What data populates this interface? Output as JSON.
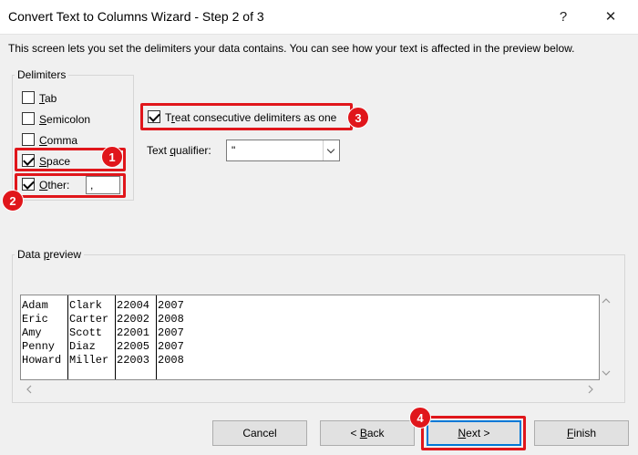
{
  "window": {
    "title": "Convert Text to Columns Wizard - Step 2 of 3",
    "help_glyph": "?",
    "close_glyph": "✕"
  },
  "instructions": "This screen lets you set the delimiters your data contains.  You can see how your text is affected in the preview below.",
  "delimiters": {
    "label": "Delimiters",
    "tab": {
      "pre": "",
      "key": "T",
      "post": "ab",
      "checked": false
    },
    "semicolon": {
      "pre": "",
      "key": "S",
      "post": "emicolon",
      "checked": false
    },
    "comma": {
      "pre": "",
      "key": "C",
      "post": "omma",
      "checked": false
    },
    "space": {
      "pre": "",
      "key": "S",
      "post": "pace",
      "checked": true
    },
    "other": {
      "pre": "",
      "key": "O",
      "post": "ther:",
      "checked": true,
      "value": ","
    }
  },
  "consecutive": {
    "pre": "T",
    "key": "r",
    "post": "eat consecutive delimiters as one",
    "checked": true
  },
  "qualifier": {
    "pre": "Text ",
    "key": "q",
    "post": "ualifier:",
    "value": "\""
  },
  "preview": {
    "label_pre": "Data ",
    "label_key": "p",
    "label_post": "review",
    "rows": [
      [
        "Adam",
        "Clark",
        "22004",
        "2007"
      ],
      [
        "Eric",
        "Carter",
        "22002",
        "2008"
      ],
      [
        "Amy",
        "Scott",
        "22001",
        "2007"
      ],
      [
        "Penny",
        "Diaz",
        "22005",
        "2007"
      ],
      [
        "Howard",
        "Miller",
        "22003",
        "2008"
      ]
    ]
  },
  "buttons": {
    "cancel": {
      "pre": "Cancel",
      "key": "",
      "post": ""
    },
    "back": {
      "pre": "< ",
      "key": "B",
      "post": "ack"
    },
    "next": {
      "pre": "",
      "key": "N",
      "post": "ext >"
    },
    "finish": {
      "pre": "",
      "key": "F",
      "post": "inish"
    }
  },
  "badges": [
    "1",
    "2",
    "3",
    "4"
  ],
  "colors": {
    "highlight": "#e0161b",
    "default_button_border": "#0078d7"
  }
}
